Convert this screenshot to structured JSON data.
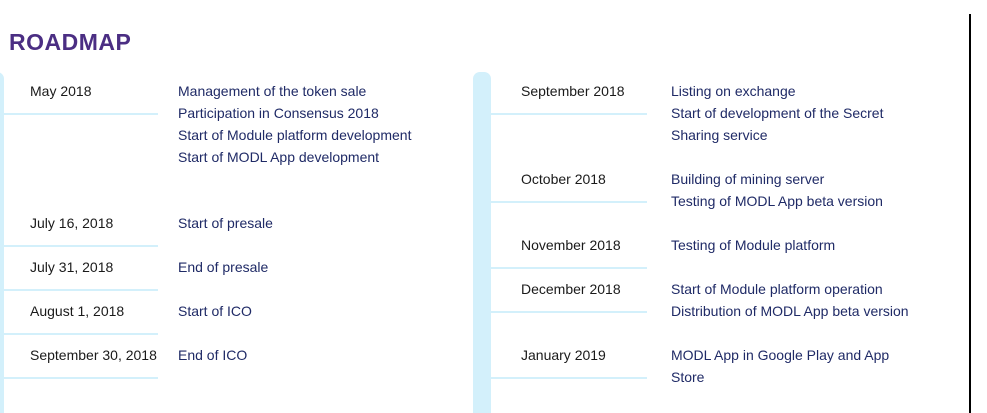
{
  "title": "ROADMAP",
  "colors": {
    "title": "#4b2e83",
    "event_text": "#1f2a66",
    "date_text": "#1a1a1a",
    "rail": "#d3f0fb"
  },
  "left_column": [
    {
      "date": "May 2018",
      "events": [
        "Management of the token sale",
        "Participation in Consensus 2018",
        "Start of Module platform development",
        "Start of MODL App development"
      ]
    },
    {
      "date": "July 16, 2018",
      "events": [
        "Start of presale"
      ]
    },
    {
      "date": "July 31, 2018",
      "events": [
        "End of presale"
      ]
    },
    {
      "date": "August 1, 2018",
      "events": [
        "Start of ICO"
      ]
    },
    {
      "date": "September 30, 2018",
      "events": [
        "End of ICO"
      ]
    }
  ],
  "right_column": [
    {
      "date": "September 2018",
      "events": [
        "Listing on exchange",
        "Start of development of the Secret Sharing service"
      ]
    },
    {
      "date": "October 2018",
      "events": [
        "Building of mining server",
        "Testing of MODL App beta version"
      ]
    },
    {
      "date": "November 2018",
      "events": [
        "Testing of Module platform"
      ]
    },
    {
      "date": "December 2018",
      "events": [
        "Start of Module platform operation",
        "Distribution of MODL App beta version"
      ]
    },
    {
      "date": "January 2019",
      "events": [
        "MODL App in Google Play and App Store"
      ]
    }
  ]
}
